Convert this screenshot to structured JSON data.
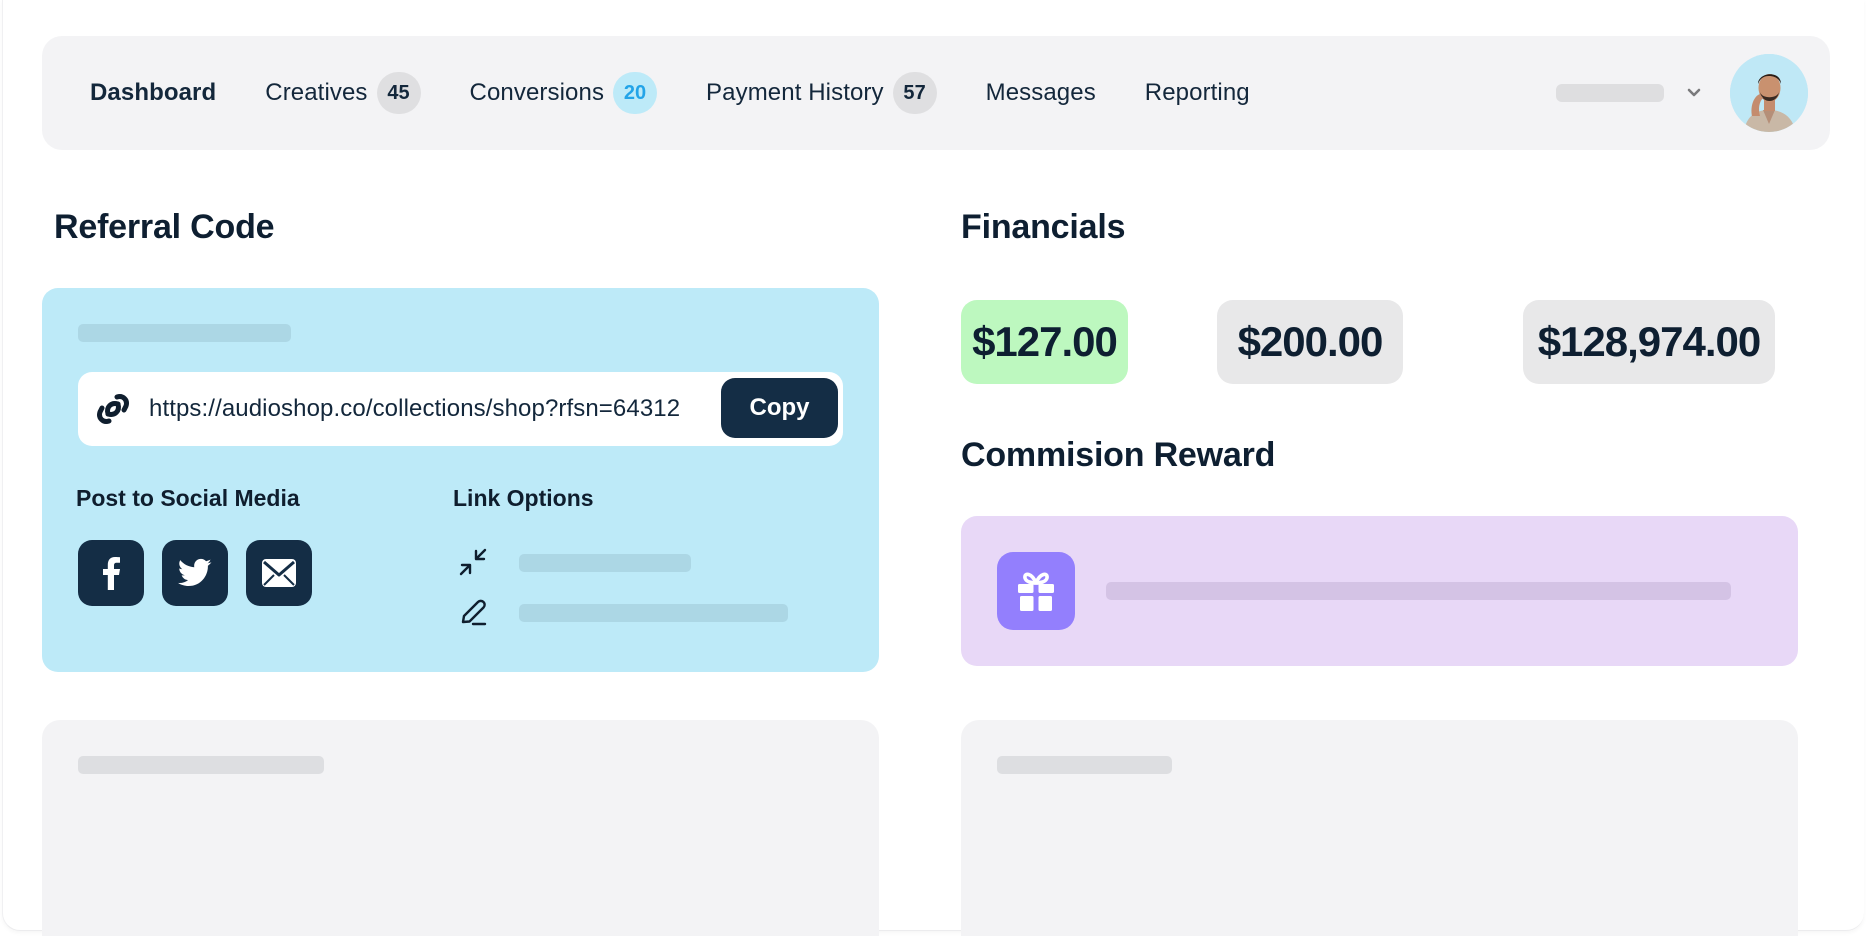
{
  "nav": {
    "items": [
      {
        "label": "Dashboard",
        "active": true,
        "badge": null
      },
      {
        "label": "Creatives",
        "active": false,
        "badge": "45"
      },
      {
        "label": "Conversions",
        "active": false,
        "badge": "20"
      },
      {
        "label": "Payment History",
        "active": false,
        "badge": "57"
      },
      {
        "label": "Messages",
        "active": false,
        "badge": null
      },
      {
        "label": "Reporting",
        "active": false,
        "badge": null
      }
    ]
  },
  "user": {
    "avatar_icon": "user-avatar-photo",
    "menu_icon": "chevron-down-icon"
  },
  "referral": {
    "title": "Referral Code",
    "url": "https://audioshop.co/collections/shop?rfsn=64312",
    "copy_label": "Copy",
    "social_title": "Post to Social Media",
    "social": [
      {
        "name": "facebook",
        "icon": "facebook-icon"
      },
      {
        "name": "twitter",
        "icon": "twitter-icon"
      },
      {
        "name": "email",
        "icon": "mail-icon"
      }
    ],
    "options_title": "Link Options",
    "options": [
      {
        "icon": "shorten-link-icon"
      },
      {
        "icon": "edit-link-icon"
      }
    ]
  },
  "financials": {
    "title": "Financials",
    "values": [
      "$127.00",
      "$200.00",
      "$128,974.00"
    ],
    "colors": {
      "highlight": "#bdf8bf",
      "neutral": "#e8e8e9"
    }
  },
  "commission": {
    "title": "Commision Reward",
    "icon": "gift-icon",
    "accent": "#937ffd"
  },
  "colors": {
    "primary_dark": "#142d45",
    "referral_bg": "#bdeaf8",
    "commission_bg": "#e8d8f7",
    "header_bg": "#f3f3f5"
  }
}
